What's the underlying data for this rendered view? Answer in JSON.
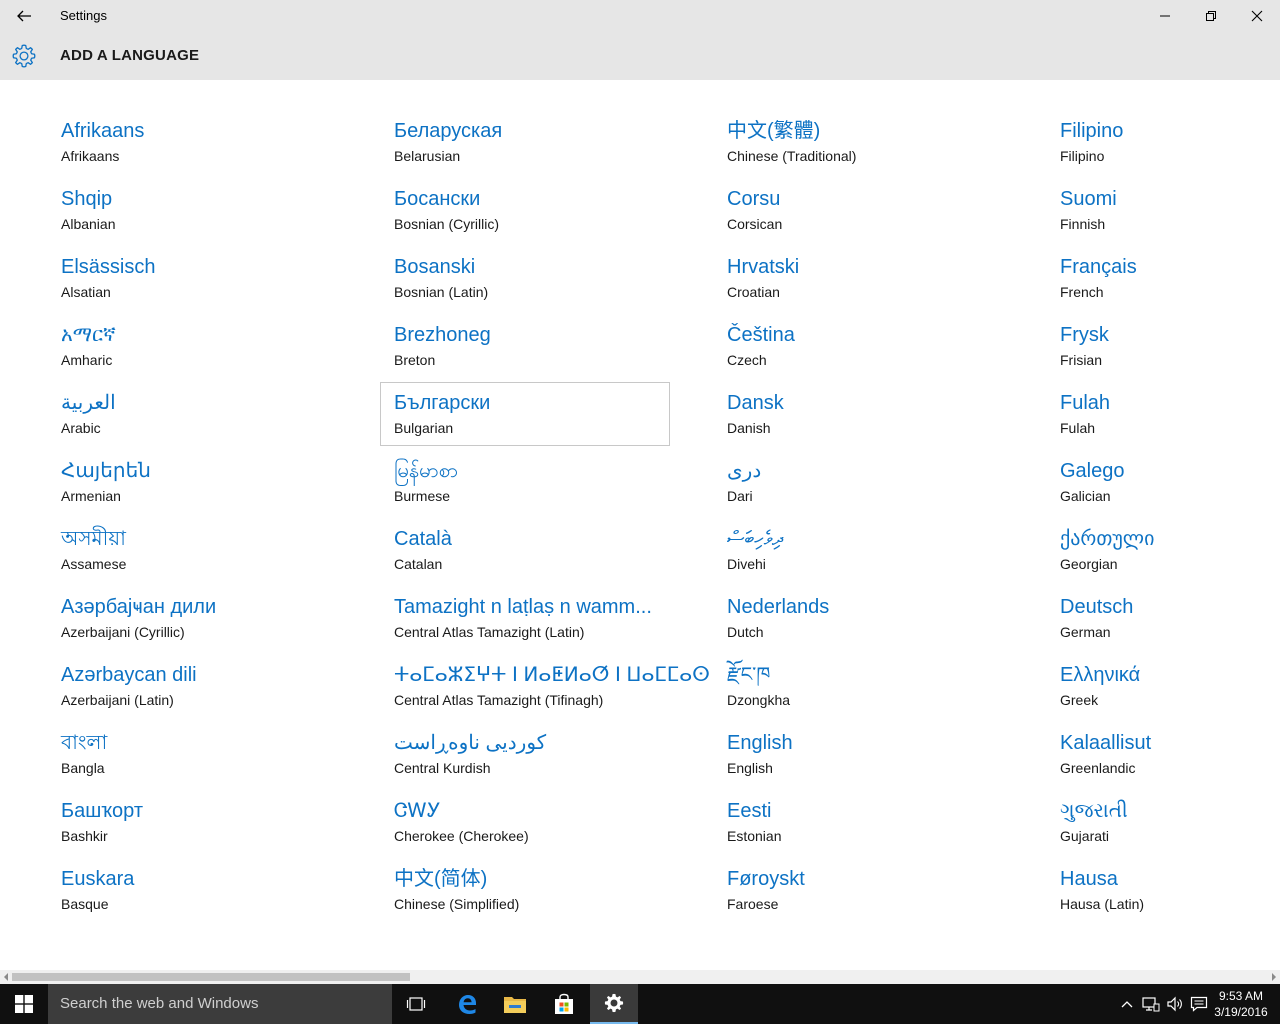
{
  "window": {
    "title": "Settings",
    "controls": {
      "minimize": "minimize-icon",
      "restore": "restore-icon",
      "close": "close-icon"
    }
  },
  "header": {
    "title": "ADD A LANGUAGE",
    "icon": "gear-icon"
  },
  "colors": {
    "accent": "#0d72c4",
    "chrome": "#e6e6e6",
    "taskbar": "#101010"
  },
  "languages": [
    [
      {
        "native": "Afrikaans",
        "english": "Afrikaans"
      },
      {
        "native": "Shqip",
        "english": "Albanian"
      },
      {
        "native": "Elsässisch",
        "english": "Alsatian"
      },
      {
        "native": "አማርኛ",
        "english": "Amharic"
      },
      {
        "native": "العربية",
        "english": "Arabic"
      },
      {
        "native": "Հայերեն",
        "english": "Armenian"
      },
      {
        "native": "অসমীয়া",
        "english": "Assamese"
      },
      {
        "native": "Азәрбајҹан дили",
        "english": "Azerbaijani (Cyrillic)"
      },
      {
        "native": "Azərbaycan dili",
        "english": "Azerbaijani (Latin)"
      },
      {
        "native": "বাংলা",
        "english": "Bangla"
      },
      {
        "native": "Башҡорт",
        "english": "Bashkir"
      },
      {
        "native": "Euskara",
        "english": "Basque"
      }
    ],
    [
      {
        "native": "Беларуская",
        "english": "Belarusian"
      },
      {
        "native": "Босански",
        "english": "Bosnian (Cyrillic)"
      },
      {
        "native": "Bosanski",
        "english": "Bosnian (Latin)"
      },
      {
        "native": "Brezhoneg",
        "english": "Breton"
      },
      {
        "native": "Български",
        "english": "Bulgarian",
        "focused": true
      },
      {
        "native": "မြန်မာစာ",
        "english": "Burmese"
      },
      {
        "native": "Català",
        "english": "Catalan"
      },
      {
        "native": "Tamazight n laṭlaṣ n wamm...",
        "english": "Central Atlas Tamazight (Latin)"
      },
      {
        "native": "ⵜⴰⵎⴰⵣⵉⵖⵜ ⵏ ⵍⴰⵟⵍⴰⵚ ⵏ ⵡⴰⵎⵎⴰⵙ",
        "english": "Central Atlas Tamazight (Tifinagh)"
      },
      {
        "native": "کوردیی ناوەڕاست",
        "english": "Central Kurdish"
      },
      {
        "native": "ᏣᎳᎩ",
        "english": "Cherokee (Cherokee)"
      },
      {
        "native": "中文(简体)",
        "english": "Chinese (Simplified)"
      }
    ],
    [
      {
        "native": "中文(繁體)",
        "english": "Chinese (Traditional)"
      },
      {
        "native": "Corsu",
        "english": "Corsican"
      },
      {
        "native": "Hrvatski",
        "english": "Croatian"
      },
      {
        "native": "Čeština",
        "english": "Czech"
      },
      {
        "native": "Dansk",
        "english": "Danish"
      },
      {
        "native": "دری",
        "english": "Dari"
      },
      {
        "native": "ދިވެހިބަސް",
        "english": "Divehi"
      },
      {
        "native": "Nederlands",
        "english": "Dutch"
      },
      {
        "native": "རྫོང་ཁ",
        "english": "Dzongkha"
      },
      {
        "native": "English",
        "english": "English"
      },
      {
        "native": "Eesti",
        "english": "Estonian"
      },
      {
        "native": "Føroyskt",
        "english": "Faroese"
      }
    ],
    [
      {
        "native": "Filipino",
        "english": "Filipino"
      },
      {
        "native": "Suomi",
        "english": "Finnish"
      },
      {
        "native": "Français",
        "english": "French"
      },
      {
        "native": "Frysk",
        "english": "Frisian"
      },
      {
        "native": "Fulah",
        "english": "Fulah"
      },
      {
        "native": "Galego",
        "english": "Galician"
      },
      {
        "native": "ქართული",
        "english": "Georgian"
      },
      {
        "native": "Deutsch",
        "english": "German"
      },
      {
        "native": "Ελληνικά",
        "english": "Greek"
      },
      {
        "native": "Kalaallisut",
        "english": "Greenlandic"
      },
      {
        "native": "ગુજરાતી",
        "english": "Gujarati"
      },
      {
        "native": "Hausa",
        "english": "Hausa (Latin)"
      }
    ]
  ],
  "taskbar": {
    "search_placeholder": "Search the web and Windows",
    "clock": {
      "time": "9:53 AM",
      "date": "3/19/2016"
    }
  }
}
